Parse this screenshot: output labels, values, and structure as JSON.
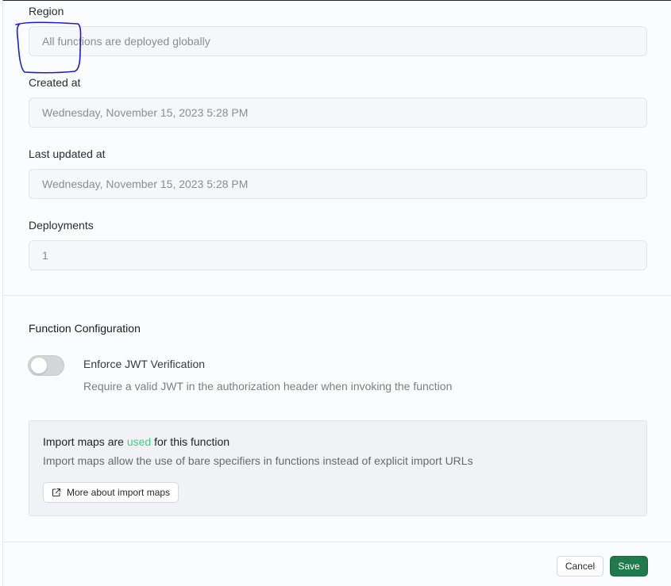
{
  "fields": [
    {
      "label": "Region",
      "value": "All functions are deployed globally"
    },
    {
      "label": "Created at",
      "value": "Wednesday, November 15, 2023 5:28 PM"
    },
    {
      "label": "Last updated at",
      "value": "Wednesday, November 15, 2023 5:28 PM"
    },
    {
      "label": "Deployments",
      "value": "1"
    }
  ],
  "config": {
    "title": "Function Configuration",
    "jwt_toggle": {
      "label": "Enforce JWT Verification",
      "description": "Require a valid JWT in the authorization header when invoking the function",
      "enabled": false
    }
  },
  "import_maps": {
    "prefix": "Import maps are ",
    "highlight": "used",
    "suffix": " for this function",
    "description": "Import maps allow the use of bare specifiers in functions instead of explicit import URLs",
    "button_label": "More about import maps",
    "highlight_color": "#3ecf8e"
  },
  "footer": {
    "cancel_label": "Cancel",
    "save_label": "Save",
    "save_color": "#1f7a4d"
  },
  "icons": {
    "external_link": "external-link-icon"
  }
}
